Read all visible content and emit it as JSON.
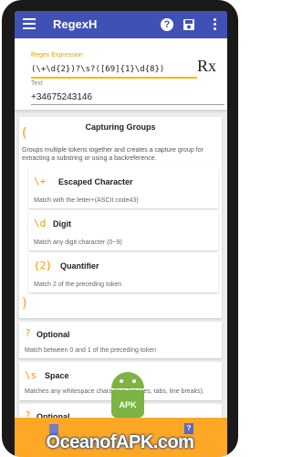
{
  "app": {
    "title": "RegexH",
    "help_glyph": "?"
  },
  "inputs": {
    "regex_label": "Regex Expression",
    "regex_value": "(\\+\\d{2})?\\s?([69]{1}\\d{8})",
    "rx_button": "Rx",
    "text_label": "Text",
    "text_value": "+34675243146"
  },
  "group": {
    "open": "(",
    "close": ")",
    "title": "Capturing Groups",
    "description": "Groups multiple tokens together and creates a capture group for extracting a substring or using a backreference.",
    "tokens": [
      {
        "token": "\\+",
        "name": "Escaped Character",
        "desc": "Match with the letter+(ASCII code43)"
      },
      {
        "token": "\\d",
        "name": "Digit",
        "desc": "Match any digit character (0−9)"
      },
      {
        "token": "{2}",
        "name": "Quantifier",
        "desc": "Match 2 of the preceding token"
      }
    ]
  },
  "cards": [
    {
      "token": "?",
      "name": "Optional",
      "desc": "Match between 0 and 1 of the preceding token"
    },
    {
      "token": "\\s",
      "name": "Space",
      "desc": "Matches any whitespace characters (spaces, tabs, line breaks)."
    },
    {
      "token": "?",
      "name": "Optional",
      "desc": ""
    }
  ],
  "badge": {
    "apk": "APK"
  },
  "watermark": "OceanofAPK.com",
  "colors": {
    "appbar": "#3f51b5",
    "accent": "#ff9800",
    "bottom_bar": "#ffa726"
  }
}
